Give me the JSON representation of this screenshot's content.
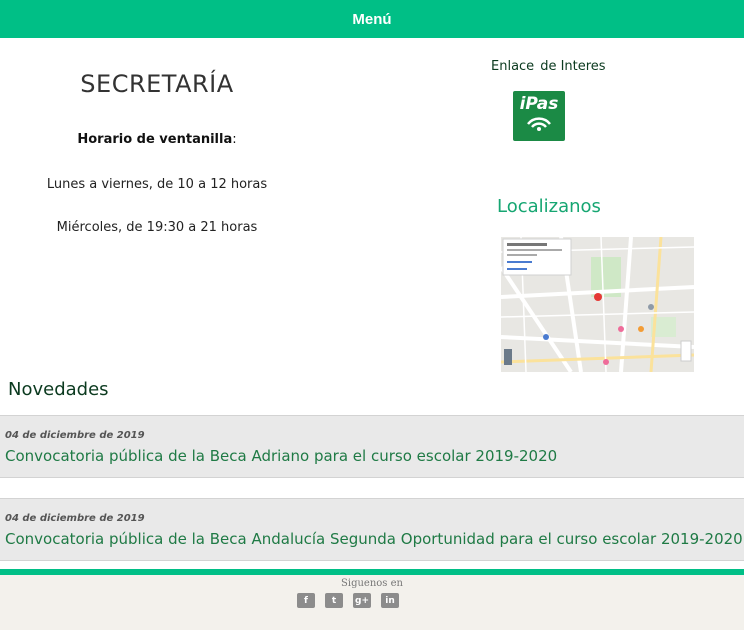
{
  "header": {
    "menu_label": "Menú"
  },
  "secretaria": {
    "title": "SECRETARÍA",
    "hours_label": "Horario de ventanilla",
    "hours_suffix": ":",
    "schedule": [
      "Lunes a viernes, de 10 a 12 horas",
      "Miércoles, de 19:30 a 21 horas"
    ]
  },
  "sidebar": {
    "link_title_a": "Enlace",
    "link_title_b": "de Interes",
    "ipas_label": "iPas",
    "locate_title": "Localizanos"
  },
  "news": {
    "title": "Novedades",
    "items": [
      {
        "date": "04 de diciembre de 2019",
        "title": "Convocatoria pública de la Beca Adriano para el curso escolar 2019-2020"
      },
      {
        "date": "04 de diciembre de 2019",
        "title": "Convocatoria pública de la Beca Andalucía Segunda Oportunidad para el curso escolar 2019-2020"
      }
    ]
  },
  "footer": {
    "follow_label": "Siguenos en",
    "socials": [
      {
        "icon": "facebook-icon",
        "glyph": "f"
      },
      {
        "icon": "twitter-icon",
        "glyph": "t"
      },
      {
        "icon": "google-plus-icon",
        "glyph": "g+"
      },
      {
        "icon": "linkedin-icon",
        "glyph": "in"
      }
    ]
  },
  "colors": {
    "accent": "#00bf86",
    "link": "#1f7a45",
    "heading_green": "#16a672"
  }
}
